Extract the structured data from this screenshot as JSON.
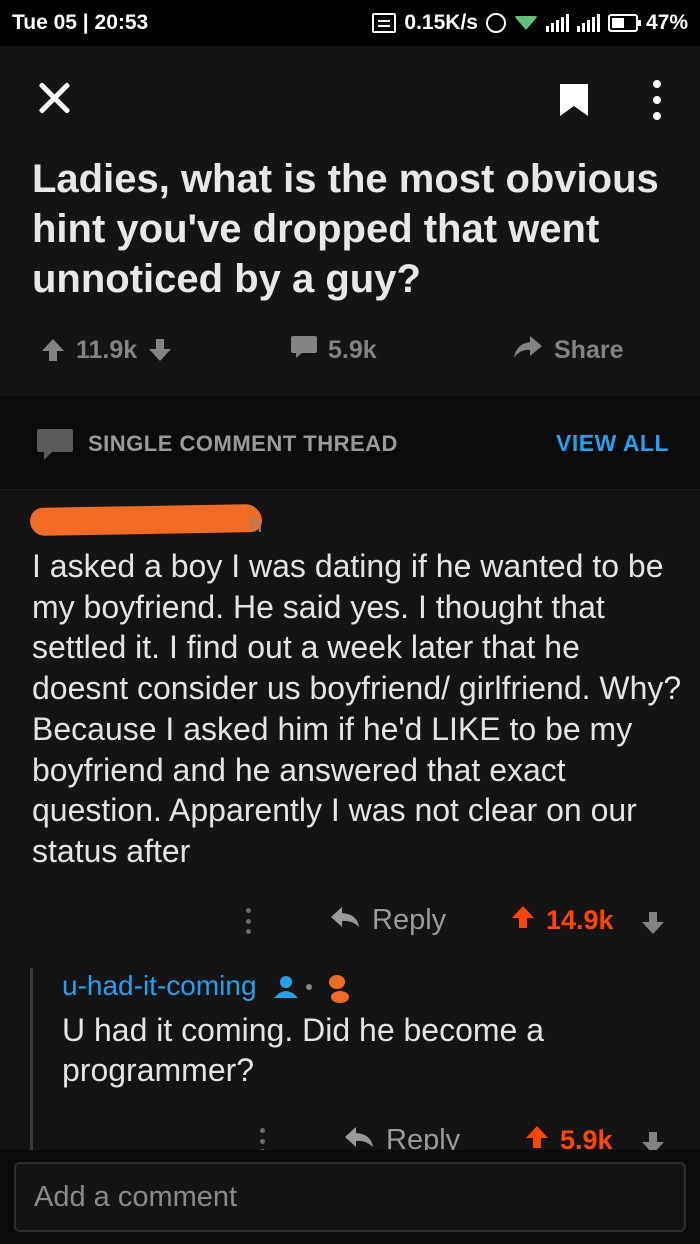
{
  "status_bar": {
    "time": "Tue 05 | 20:53",
    "network_speed": "0.15K/s",
    "battery": "47%"
  },
  "post": {
    "title": "Ladies, what is the most obvious hint you've dropped that went unnoticed by a guy?",
    "upvotes": "11.9k",
    "comments": "5.9k",
    "share_label": "Share"
  },
  "thread": {
    "label": "SINGLE COMMENT THREAD",
    "view_all": "VIEW ALL"
  },
  "comment": {
    "author_tail": "h",
    "body": "I asked a boy I was dating if he wanted to be my boyfriend. He said yes. I thought that settled it. I find out a week later that he doesnt consider us boyfriend/ girlfriend. Why? Because I asked him if he'd LIKE to be my boyfriend and he answered that exact question. Apparently I was not clear on our status after",
    "reply_label": "Reply",
    "score": "14.9k"
  },
  "reply": {
    "username": "u-had-it-coming",
    "body": "U had it coming. Did he become a programmer?",
    "reply_label": "Reply",
    "score": "5.9k"
  },
  "input": {
    "placeholder": "Add a comment"
  },
  "colors": {
    "accent_blue": "#24a0ed",
    "upvote_orange": "#ff4500",
    "redaction": "#f26b24"
  }
}
